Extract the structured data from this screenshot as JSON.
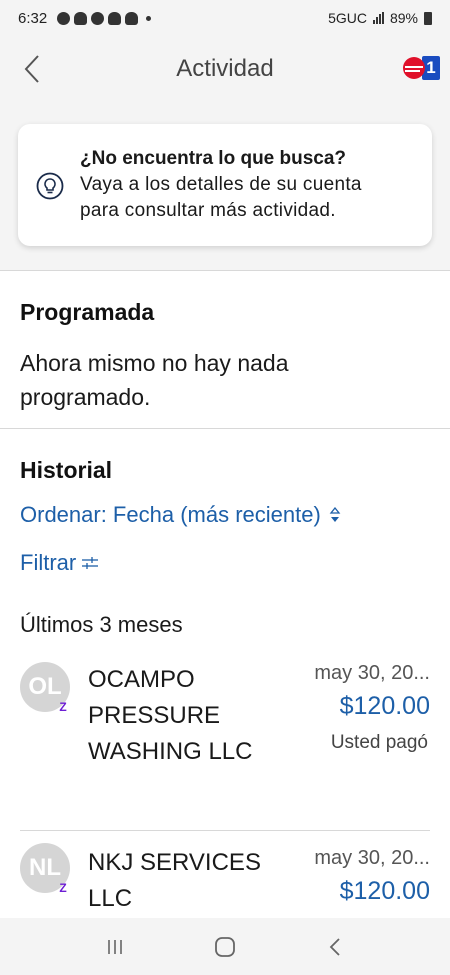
{
  "status_bar": {
    "time": "6:32",
    "network": "5GUC",
    "battery": "89%"
  },
  "header": {
    "title": "Actividad",
    "brand_number": "1"
  },
  "info_card": {
    "title": "¿No encuentra lo que busca?",
    "body_line1": "Vaya a los detalles de su cuenta",
    "body_line2": "para consultar más actividad."
  },
  "scheduled": {
    "title": "Programada",
    "empty_line1": "Ahora mismo no hay nada",
    "empty_line2": "programado."
  },
  "history": {
    "title": "Historial",
    "sort_label": "Ordenar: Fecha (más reciente)",
    "filter_label": "Filtrar",
    "period_label": "Últimos 3 meses",
    "transactions": [
      {
        "initials": "OL",
        "name_line1": "OCAMPO",
        "name_line2": "PRESSURE",
        "name_line3": "WASHING LLC",
        "date": "may 30, 20...",
        "amount": "$120.00",
        "note": "Usted pagó"
      },
      {
        "initials": "NL",
        "name_line1": "NKJ SERVICES",
        "name_line2": "LLC",
        "date": "may 30, 20...",
        "amount": "$120.00"
      }
    ]
  },
  "colors": {
    "link_blue": "#1d5fa8",
    "zelle_purple": "#6d1ed4",
    "brand_red": "#e0102a",
    "brand_blue": "#1a4cc0"
  }
}
